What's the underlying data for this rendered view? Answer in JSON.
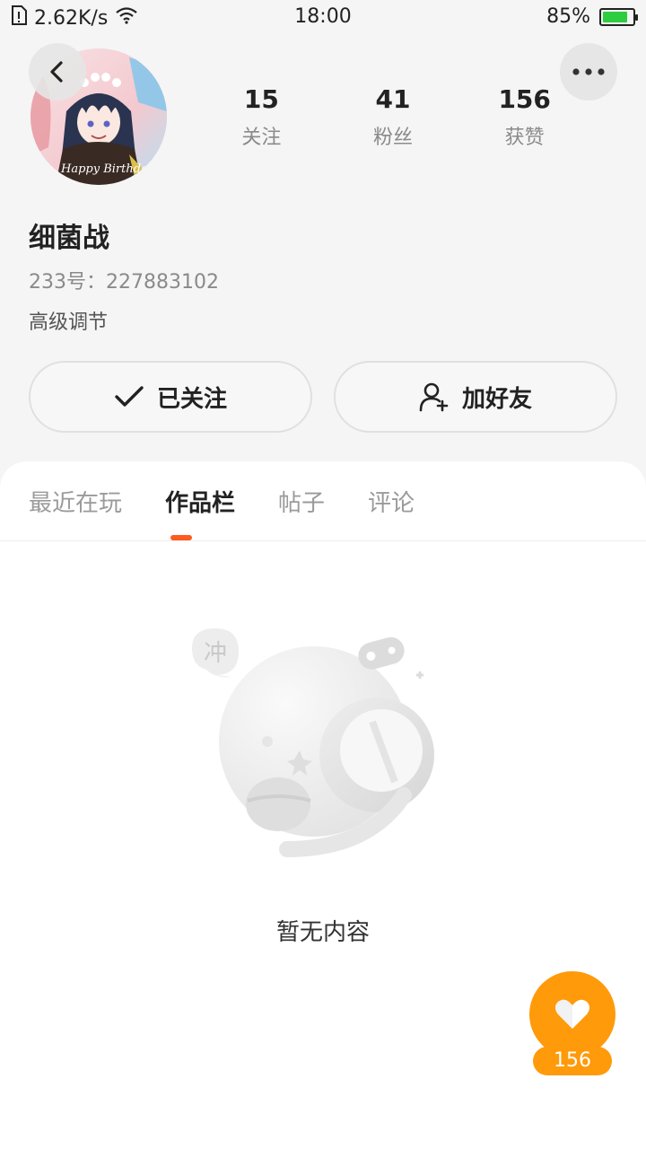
{
  "status_bar": {
    "network_speed": "2.62K/s",
    "time": "18:00",
    "battery_percent": "85%",
    "battery_level": 0.85,
    "icons": [
      "sim-icon",
      "wifi-icon",
      "battery-icon"
    ]
  },
  "header": {
    "back_icon": "chevron-left-icon",
    "more_icon": "more-horizontal-icon"
  },
  "profile": {
    "avatar_text": "Happy Birthday",
    "name": "细菌战",
    "id_line": "233号：227883102",
    "bio": "高级调节"
  },
  "stats": [
    {
      "value": "15",
      "label": "关注"
    },
    {
      "value": "41",
      "label": "粉丝"
    },
    {
      "value": "156",
      "label": "获赞"
    }
  ],
  "actions": {
    "follow_label": "已关注",
    "add_friend_label": "加好友"
  },
  "tabs": [
    {
      "label": "最近在玩",
      "active": false
    },
    {
      "label": "作品栏",
      "active": true
    },
    {
      "label": "帖子",
      "active": false
    },
    {
      "label": "评论",
      "active": false
    }
  ],
  "empty_state": {
    "bubble_text": "冲",
    "message": "暂无内容"
  },
  "like_fab": {
    "count": "156",
    "icon": "heart-icon"
  },
  "colors": {
    "accent": "#ff5a1f",
    "like_button": "#ff9a0a",
    "battery": "#2ecc40"
  }
}
